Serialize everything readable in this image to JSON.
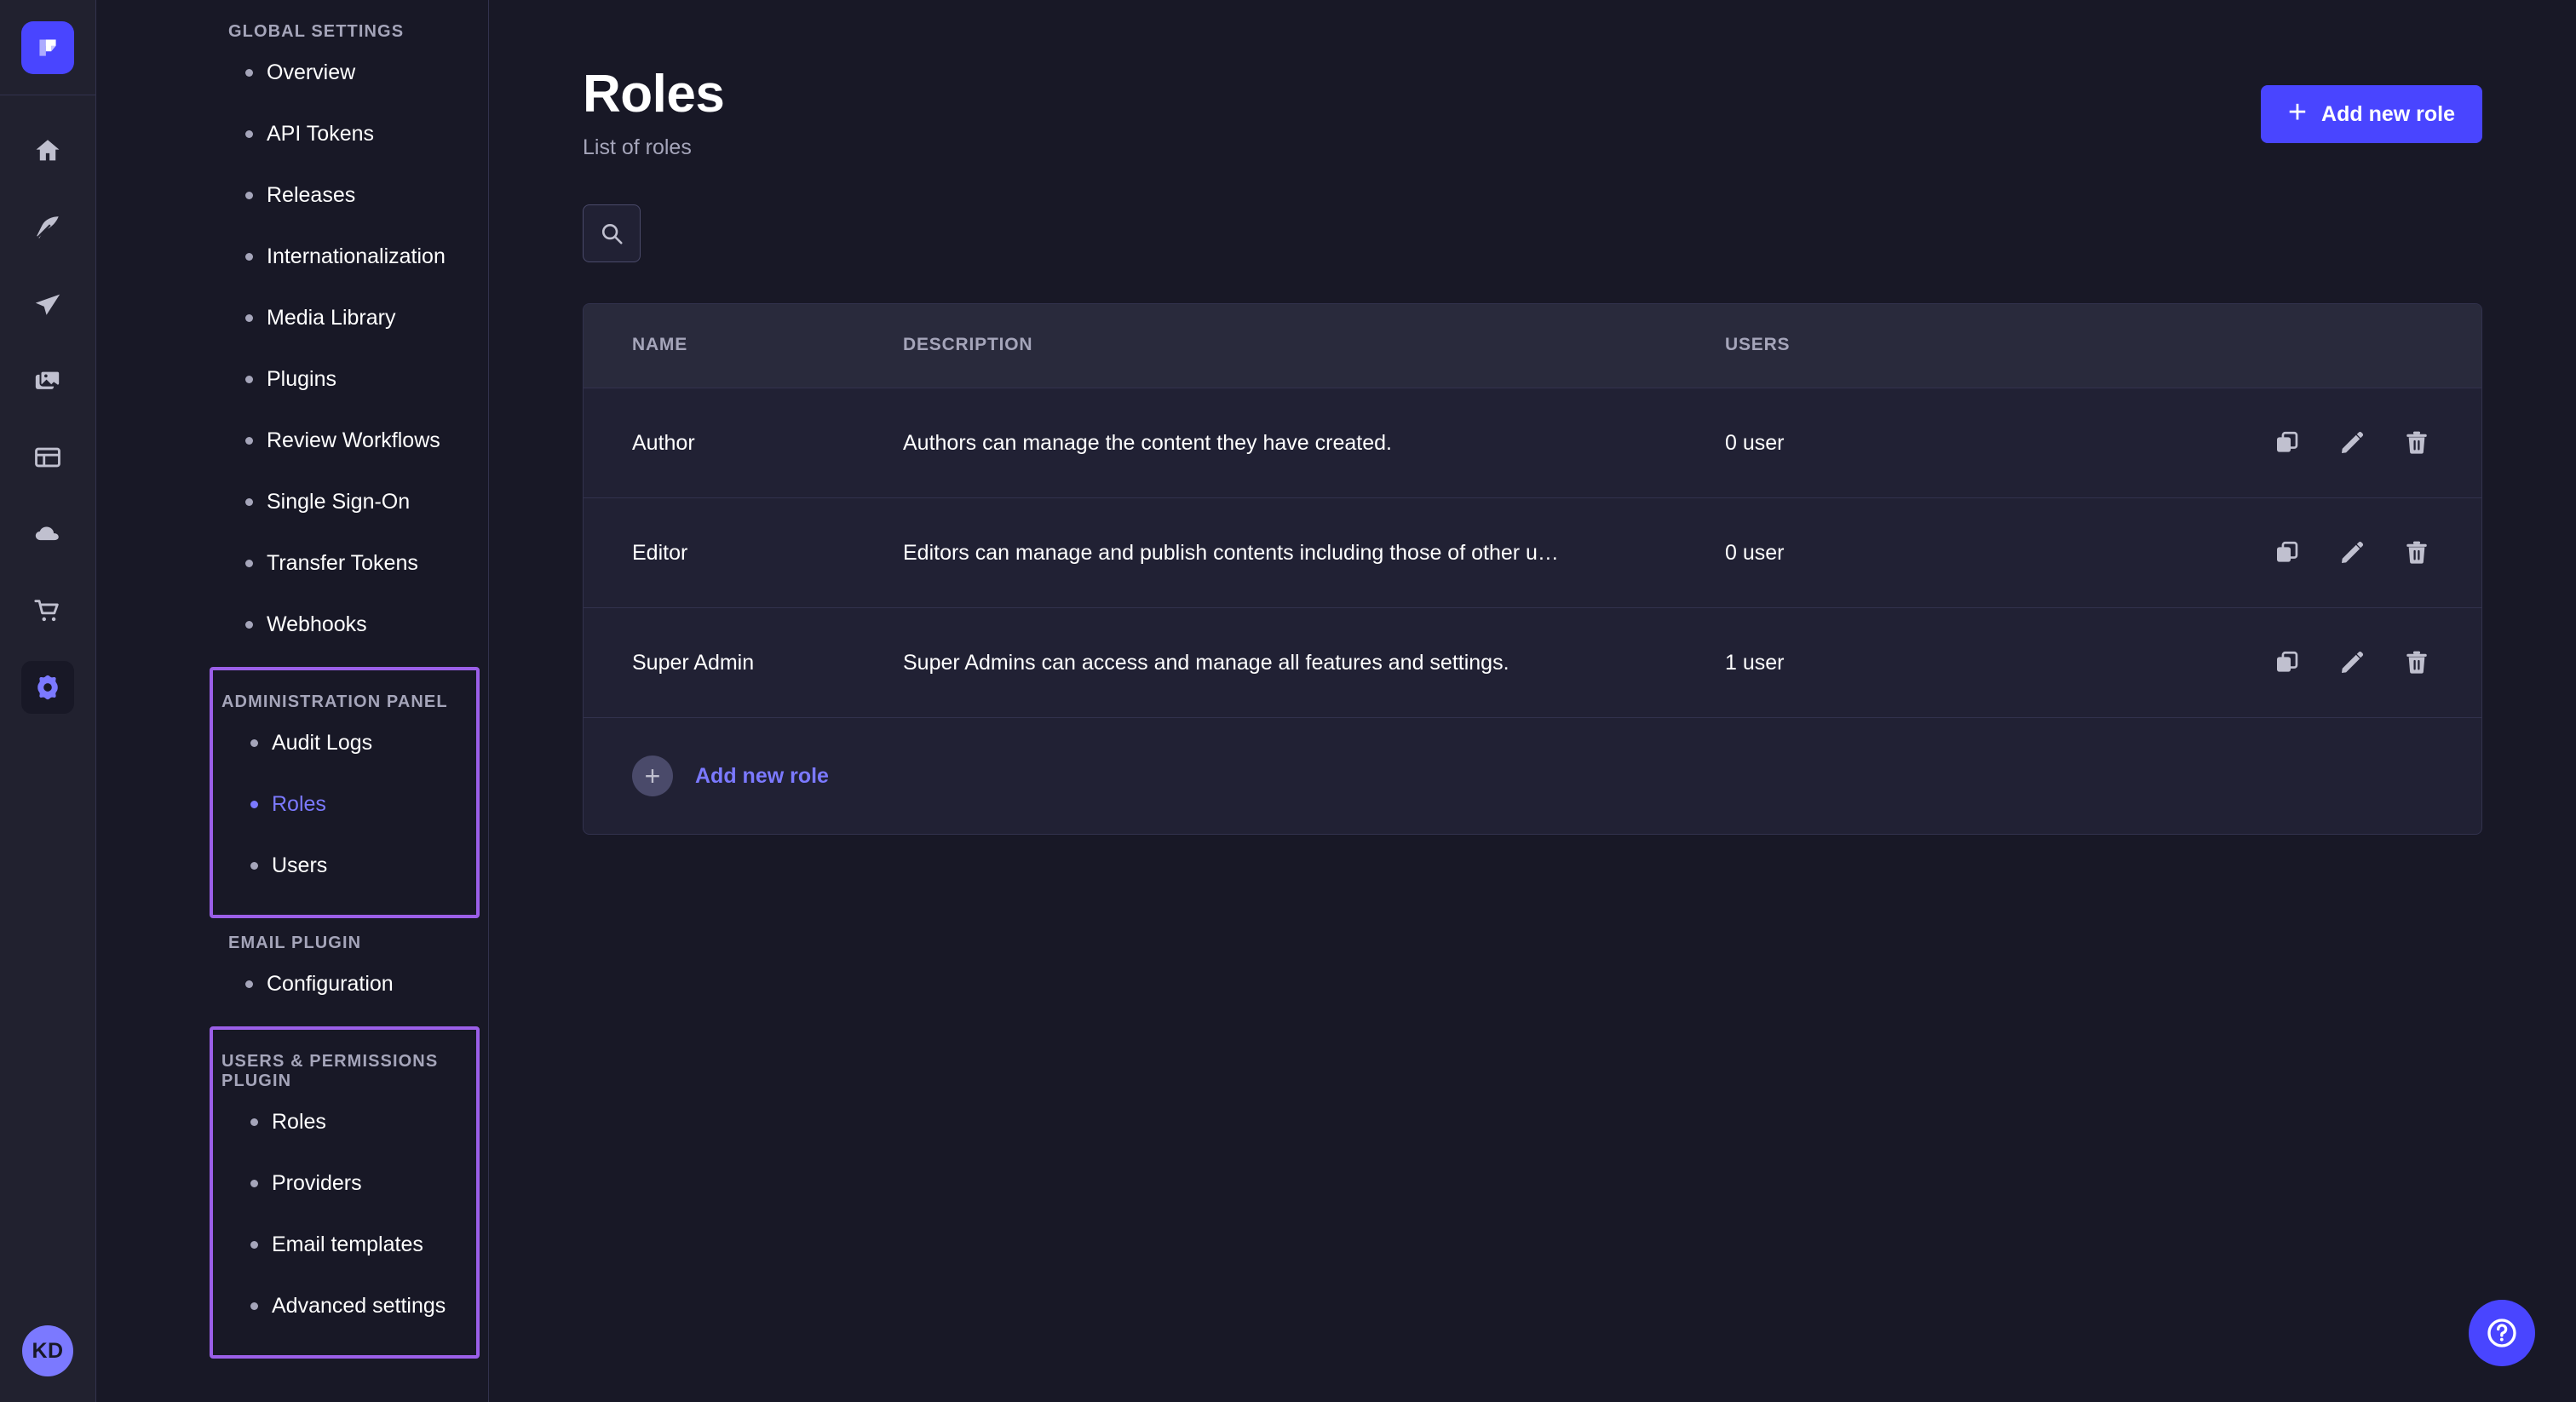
{
  "brand": {
    "logo_icon": "strapi-logo-icon",
    "accent": "#4945ff",
    "highlight": "#9b5fe8"
  },
  "rail": {
    "items": [
      {
        "icon": "home-icon",
        "name": "home"
      },
      {
        "icon": "feather-icon",
        "name": "content-manager"
      },
      {
        "icon": "paper-plane-icon",
        "name": "content-type-builder"
      },
      {
        "icon": "media-images-icon",
        "name": "media-library"
      },
      {
        "icon": "layout-icon",
        "name": "layout"
      },
      {
        "icon": "cloud-icon",
        "name": "cloud"
      },
      {
        "icon": "shopping-cart-icon",
        "name": "marketplace"
      },
      {
        "icon": "gear-icon",
        "name": "settings"
      }
    ],
    "avatar_initials": "KD"
  },
  "sidebar": {
    "groups": [
      {
        "title": "GLOBAL SETTINGS",
        "highlighted": false,
        "items": [
          {
            "label": "Overview",
            "active": false
          },
          {
            "label": "API Tokens",
            "active": false
          },
          {
            "label": "Releases",
            "active": false
          },
          {
            "label": "Internationalization",
            "active": false
          },
          {
            "label": "Media Library",
            "active": false
          },
          {
            "label": "Plugins",
            "active": false
          },
          {
            "label": "Review Workflows",
            "active": false
          },
          {
            "label": "Single Sign-On",
            "active": false
          },
          {
            "label": "Transfer Tokens",
            "active": false
          },
          {
            "label": "Webhooks",
            "active": false
          }
        ]
      },
      {
        "title": "ADMINISTRATION PANEL",
        "highlighted": true,
        "items": [
          {
            "label": "Audit Logs",
            "active": false
          },
          {
            "label": "Roles",
            "active": true
          },
          {
            "label": "Users",
            "active": false
          }
        ]
      },
      {
        "title": "EMAIL PLUGIN",
        "highlighted": false,
        "items": [
          {
            "label": "Configuration",
            "active": false
          }
        ]
      },
      {
        "title": "USERS & PERMISSIONS PLUGIN",
        "highlighted": true,
        "items": [
          {
            "label": "Roles",
            "active": false
          },
          {
            "label": "Providers",
            "active": false
          },
          {
            "label": "Email templates",
            "active": false
          },
          {
            "label": "Advanced settings",
            "active": false
          }
        ]
      }
    ]
  },
  "header": {
    "title": "Roles",
    "subtitle": "List of roles",
    "add_button_label": "Add new role",
    "add_button_icon": "plus-icon"
  },
  "toolbar": {
    "search_icon": "search-icon"
  },
  "table": {
    "columns": [
      "NAME",
      "DESCRIPTION",
      "USERS"
    ],
    "rows": [
      {
        "name": "Author",
        "description": "Authors can manage the content they have created.",
        "users": "0 user"
      },
      {
        "name": "Editor",
        "description": "Editors can manage and publish contents including those of other u…",
        "users": "0 user"
      },
      {
        "name": "Super Admin",
        "description": "Super Admins can access and manage all features and settings.",
        "users": "1 user"
      }
    ],
    "row_action_icons": [
      "duplicate-icon",
      "edit-icon",
      "delete-icon"
    ],
    "footer_label": "Add new role",
    "footer_icon": "plus-icon"
  },
  "help": {
    "icon": "question-mark-icon"
  }
}
